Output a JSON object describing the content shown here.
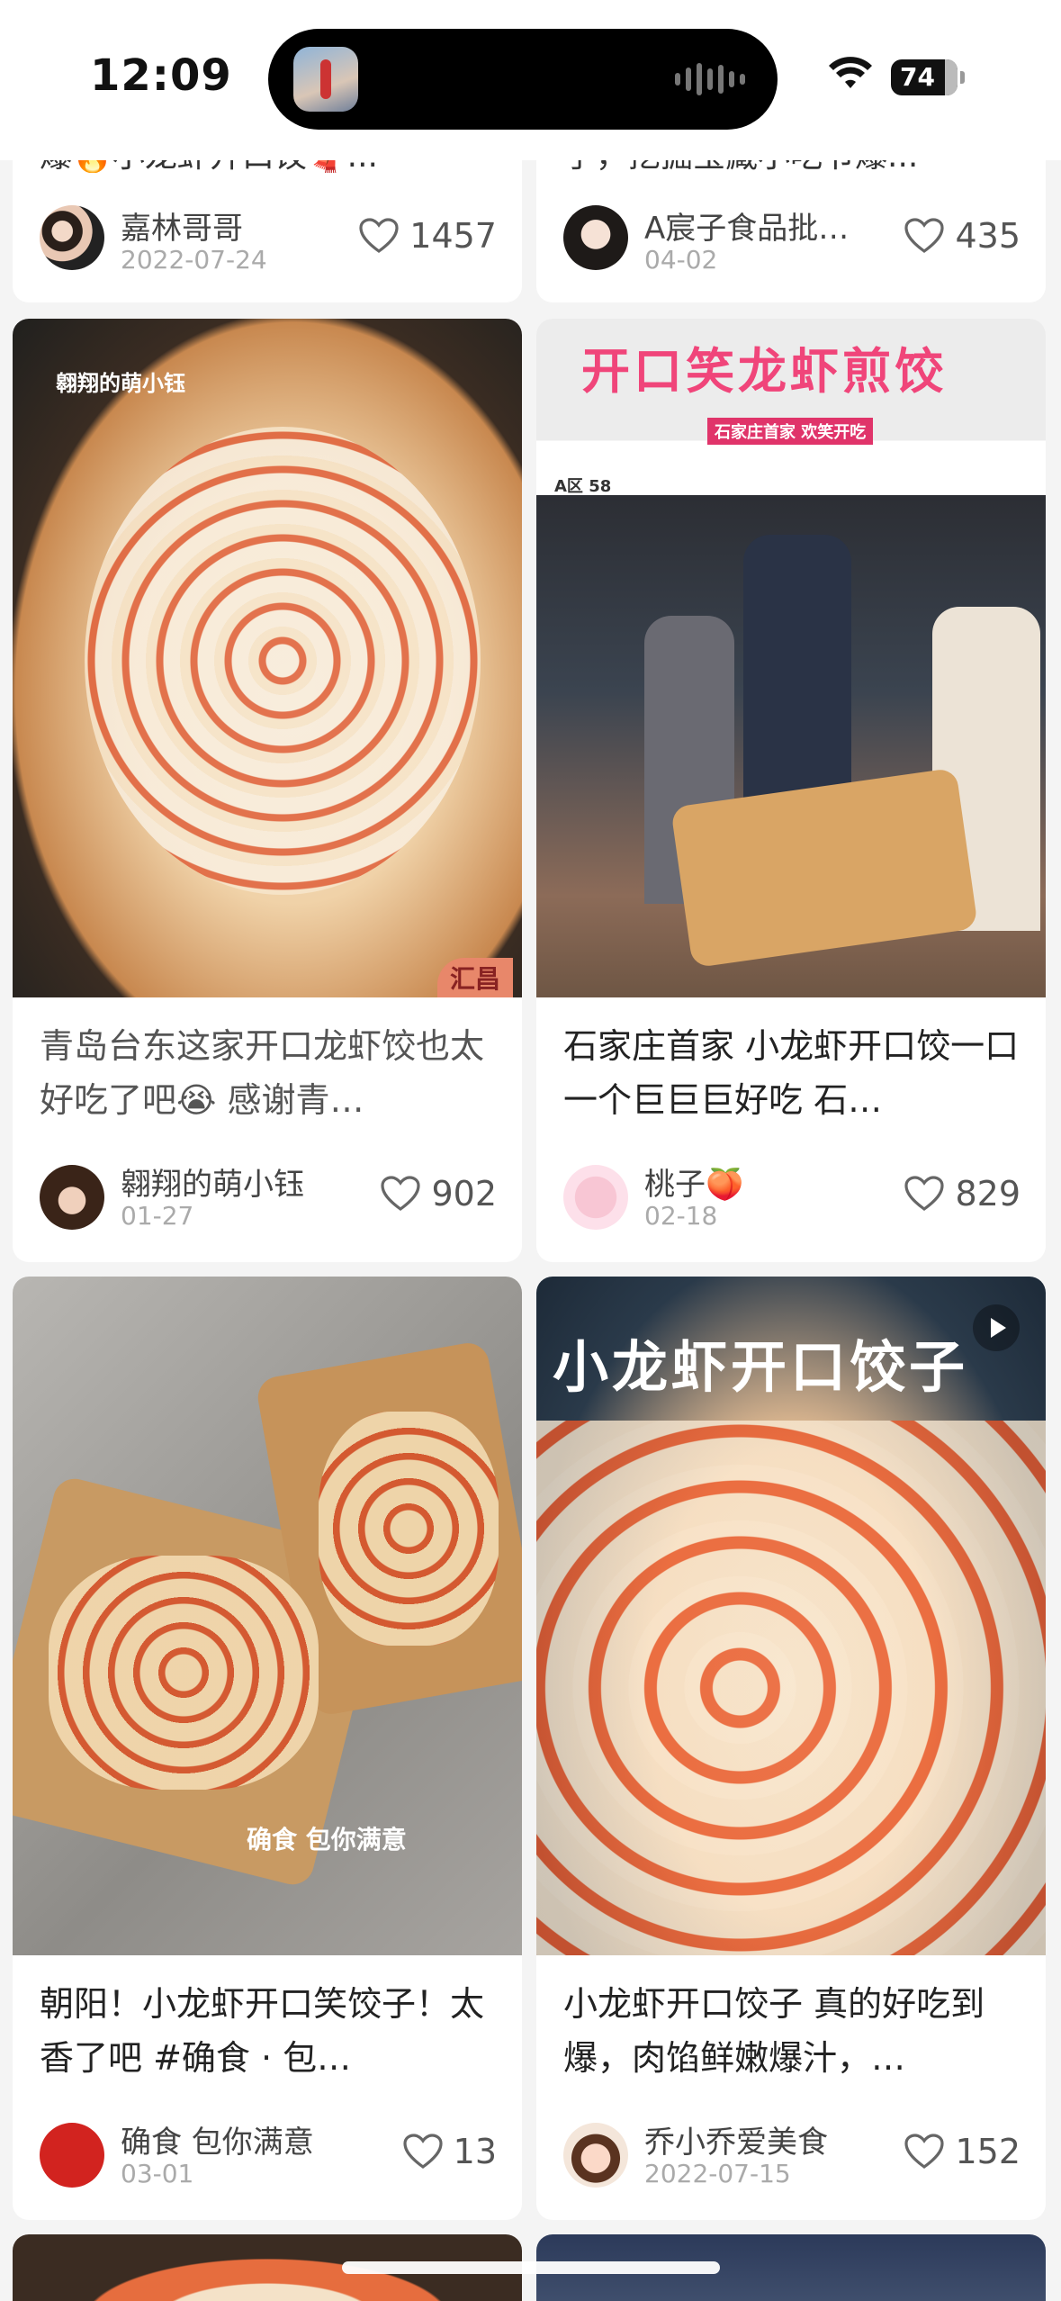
{
  "status_bar": {
    "time": "12:09",
    "battery": "74"
  },
  "top_cards": [
    {
      "title_fragment": "爆🔥小龙虾开口饺🧣...",
      "author": "嘉林哥哥",
      "date": "2022-07-24",
      "likes": "1457"
    },
    {
      "title_fragment": "了，挖掘宝藏小吃节爆...",
      "author": "A宸子食品批…",
      "date": "04-02",
      "likes": "435"
    }
  ],
  "cards": [
    {
      "title": "青岛台东这家开口龙虾饺也太好吃了吧😭 感谢青…",
      "author": "翱翔的萌小钰",
      "date": "01-27",
      "likes": "902",
      "image_text": "翱翔的萌小钰",
      "image_corner": "汇昌"
    },
    {
      "title": "石家庄首家 小龙虾开口饺一口一个巨巨巨好吃 石…",
      "author": "桃子🍑",
      "date": "02-18",
      "likes": "829",
      "sign": "开口笑龙虾煎饺",
      "sign_sub": "石家庄首家 欢笑开吃",
      "shop_code": "A区 58"
    },
    {
      "title": "朝阳！小龙虾开口笑饺子！太香了吧 #确食 · 包…",
      "author": "确食 包你满意",
      "date": "03-01",
      "likes": "13",
      "image_text": "确食 包你满意"
    },
    {
      "title": "小龙虾开口饺子 真的好吃到爆，肉馅鲜嫩爆汁，…",
      "author": "乔小乔爱美食",
      "date": "2022-07-15",
      "likes": "152",
      "image_headline": "小龙虾开口饺子",
      "is_video": true
    }
  ],
  "colors": {
    "sign_pink": "#f0457a",
    "heart": "#666666"
  }
}
